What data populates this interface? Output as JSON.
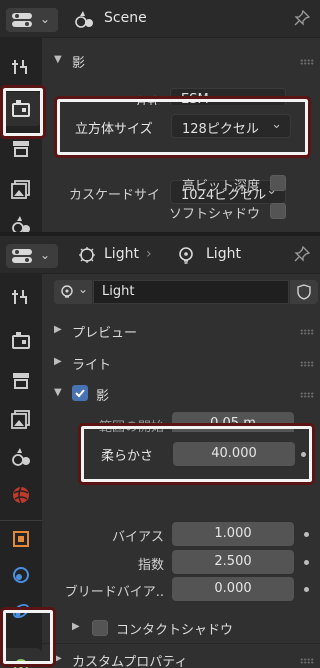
{
  "top_panel": {
    "header": {
      "context_label": "Scene"
    },
    "shadow_section": {
      "label": "影"
    },
    "rows": {
      "method_label": "方式",
      "method_value": "ESM",
      "cube_size_label": "立方体サイズ",
      "cube_size_value": "128ピクセル",
      "cascade_size_label": "カスケードサイ",
      "cascade_size_value": "1024ピクセル",
      "high_bit_depth_label": "高ビット深度",
      "soft_shadows_label": "ソフトシャドウ"
    }
  },
  "bottom_panel": {
    "header": {
      "object_label": "Light",
      "data_label": "Light"
    },
    "datablock": {
      "name": "Light"
    },
    "sections": {
      "preview": "プレビュー",
      "light": "ライト",
      "shadow": "影",
      "contact_shadow": "コンタクトシャドウ",
      "custom_props": "カスタムプロパティ"
    },
    "fields": {
      "clip_start_label": "範囲の開始",
      "clip_start_value": "0.05 m",
      "softness_label": "柔らかさ",
      "softness_value": "40.000",
      "bias_label": "バイアス",
      "bias_value": "1.000",
      "exponent_label": "指数",
      "exponent_value": "2.500",
      "bleed_bias_label": "ブリードバイア..",
      "bleed_bias_value": "0.000"
    }
  },
  "colors": {
    "highlight_border": "#f3f3f3",
    "highlight_outline": "#5a1414",
    "checkbox_on": "#4772b3",
    "light_icon_active": "#8fd35b"
  }
}
